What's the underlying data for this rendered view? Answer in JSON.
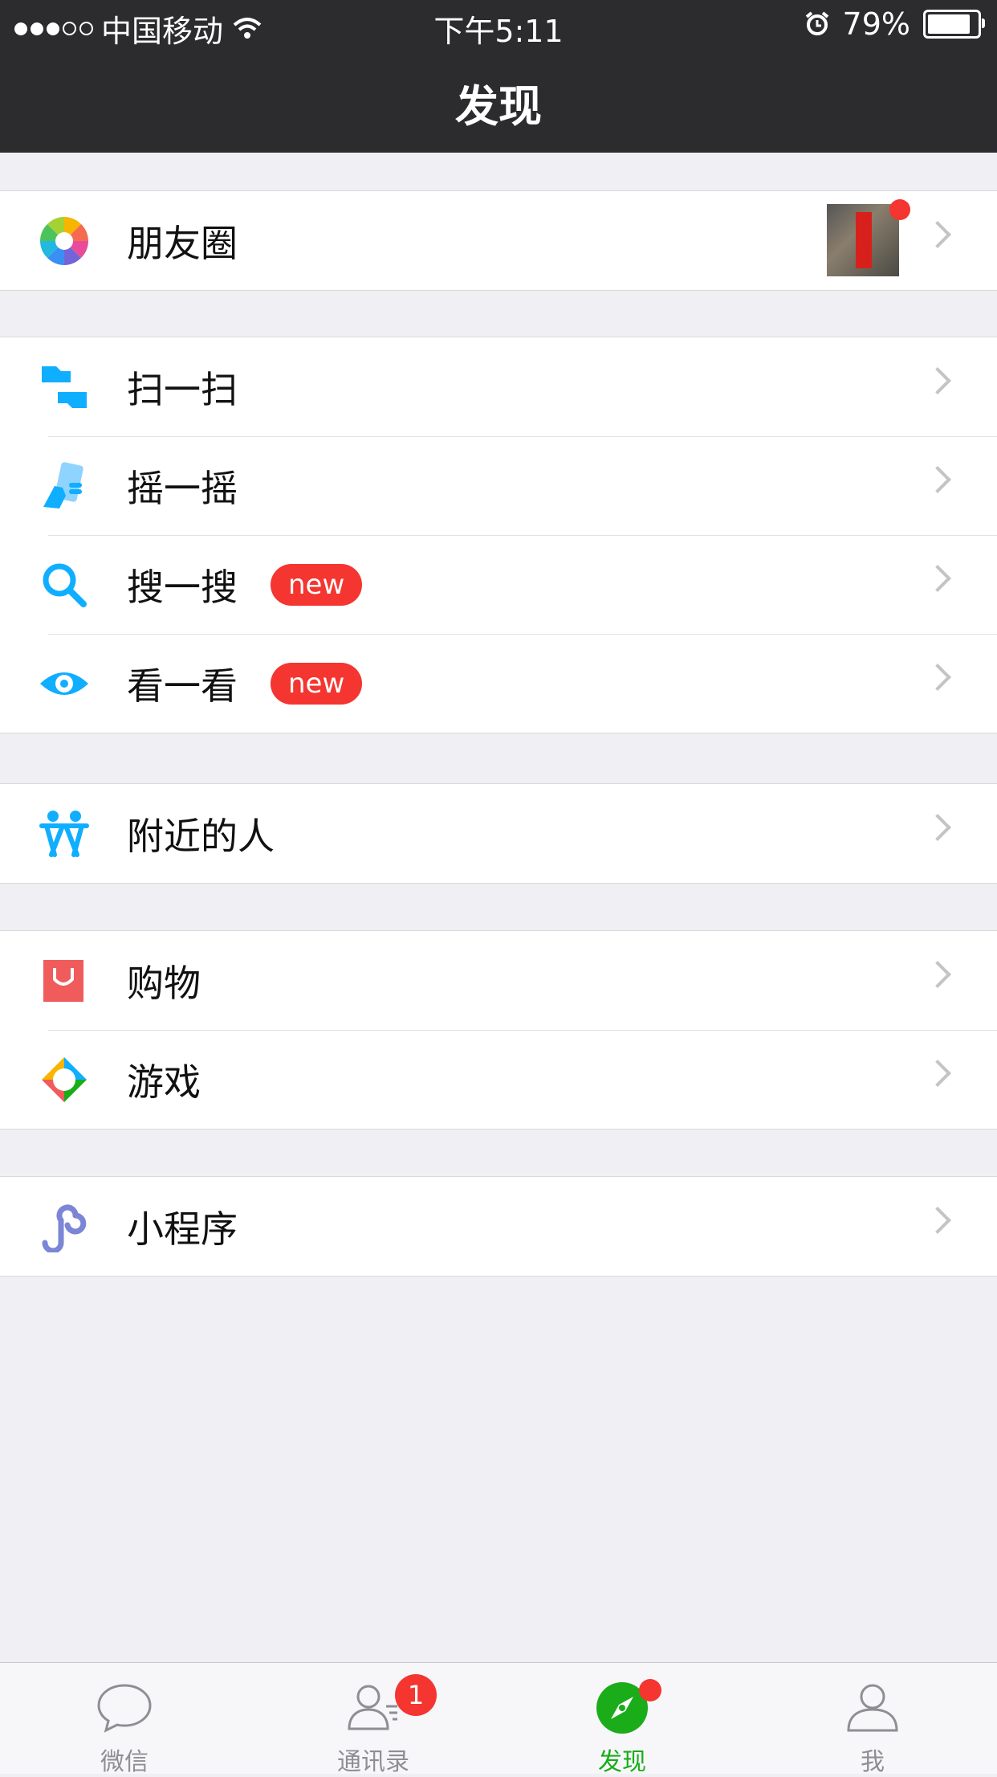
{
  "status_bar": {
    "carrier": "中国移动",
    "time": "下午5:11",
    "battery": "79%",
    "battery_level": 0.79
  },
  "nav": {
    "title": "发现"
  },
  "sections": [
    {
      "items": [
        {
          "label": "朋友圈",
          "icon": "moments-icon",
          "has_thumbnail": true
        }
      ]
    },
    {
      "items": [
        {
          "label": "扫一扫",
          "icon": "scan-icon"
        },
        {
          "label": "摇一摇",
          "icon": "shake-icon"
        },
        {
          "label": "搜一搜",
          "icon": "search-icon",
          "badge": "new"
        },
        {
          "label": "看一看",
          "icon": "eye-icon",
          "badge": "new"
        }
      ]
    },
    {
      "items": [
        {
          "label": "附近的人",
          "icon": "nearby-people-icon"
        }
      ]
    },
    {
      "items": [
        {
          "label": "购物",
          "icon": "shopping-bag-icon"
        },
        {
          "label": "游戏",
          "icon": "games-icon"
        }
      ]
    },
    {
      "items": [
        {
          "label": "小程序",
          "icon": "mini-program-icon"
        }
      ]
    }
  ],
  "tabbar": {
    "tabs": [
      {
        "label": "微信",
        "icon": "chat-bubble-icon"
      },
      {
        "label": "通讯录",
        "icon": "contacts-icon",
        "badge": "1"
      },
      {
        "label": "发现",
        "icon": "compass-icon",
        "active": true
      },
      {
        "label": "我",
        "icon": "person-icon"
      }
    ]
  },
  "colors": {
    "badge_red": "#f43530",
    "active_green": "#1aad19",
    "accent_blue": "#10aeff"
  }
}
